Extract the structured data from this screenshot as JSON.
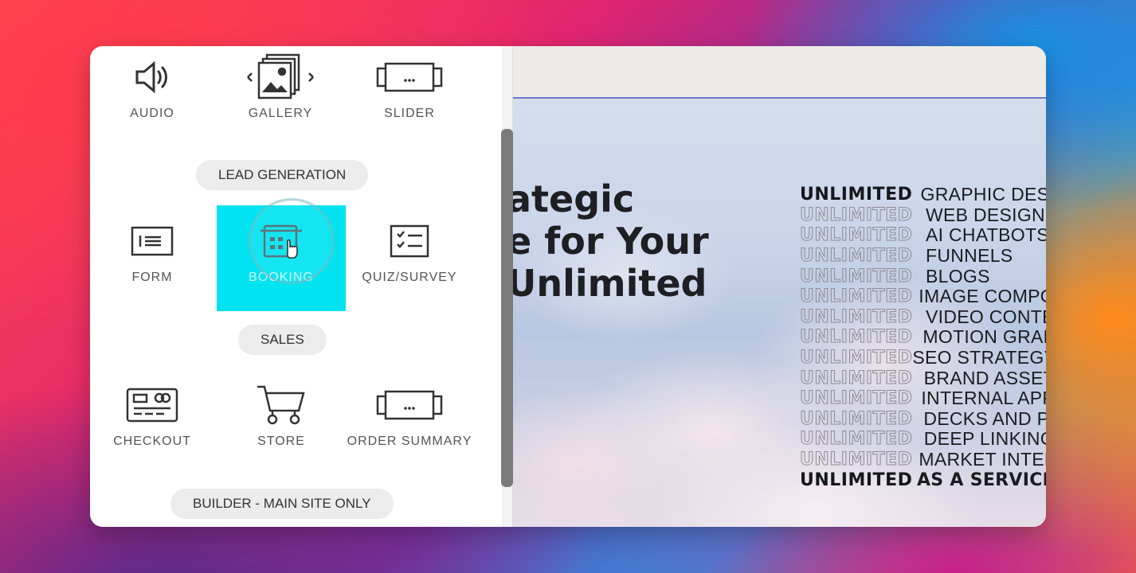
{
  "panel": {
    "top_row": [
      {
        "label": "AUDIO",
        "icon": "speaker-icon"
      },
      {
        "label": "GALLERY",
        "icon": "gallery-icon"
      },
      {
        "label": "SLIDER",
        "icon": "slider-icon"
      }
    ],
    "lead_generation": {
      "section_label": "LEAD GENERATION",
      "items": [
        {
          "label": "FORM",
          "icon": "form-icon"
        },
        {
          "label": "BOOKING",
          "icon": "booking-icon",
          "selected": true
        },
        {
          "label": "QUIZ/SURVEY",
          "icon": "quiz-icon"
        }
      ]
    },
    "sales": {
      "section_label": "SALES",
      "items": [
        {
          "label": "CHECKOUT",
          "icon": "credit-card-icon"
        },
        {
          "label": "STORE",
          "icon": "cart-icon"
        },
        {
          "label": "ORDER SUMMARY",
          "icon": "slider-icon"
        }
      ]
    },
    "builder_section_label": "BUILDER - MAIN SITE ONLY",
    "accent_color": "#00e3f1"
  },
  "canvas": {
    "headline_lines": [
      "ategic",
      "e for Your",
      "Unlimited"
    ],
    "services": [
      {
        "prefix": "UNLIMITED",
        "label": "GRAPHIC DESI",
        "emphasis": true
      },
      {
        "prefix": "UNLIMITED",
        "label": "WEB DESIGN"
      },
      {
        "prefix": "UNLIMITED",
        "label": "AI CHATBOTS"
      },
      {
        "prefix": "UNLIMITED",
        "label": "FUNNELS"
      },
      {
        "prefix": "UNLIMITED",
        "label": "BLOGS"
      },
      {
        "prefix": "UNLIMITED",
        "label": "IMAGE COMPO"
      },
      {
        "prefix": "UNLIMITED",
        "label": "VIDEO CONTE"
      },
      {
        "prefix": "UNLIMITED",
        "label": "MOTION GRAF"
      },
      {
        "prefix": "UNLIMITED",
        "label": "SEO STRATEGY"
      },
      {
        "prefix": "UNLIMITED",
        "label": "BRAND ASSET"
      },
      {
        "prefix": "UNLIMITED",
        "label": "INTERNAL APP"
      },
      {
        "prefix": "UNLIMITED",
        "label": "DECKS AND PI"
      },
      {
        "prefix": "UNLIMITED",
        "label": "DEEP LINKING"
      },
      {
        "prefix": "UNLIMITED",
        "label": "MARKET INTEL"
      }
    ],
    "footer_line": {
      "prefix": "UNLIMITED",
      "label": "AS A SERVICE"
    }
  }
}
